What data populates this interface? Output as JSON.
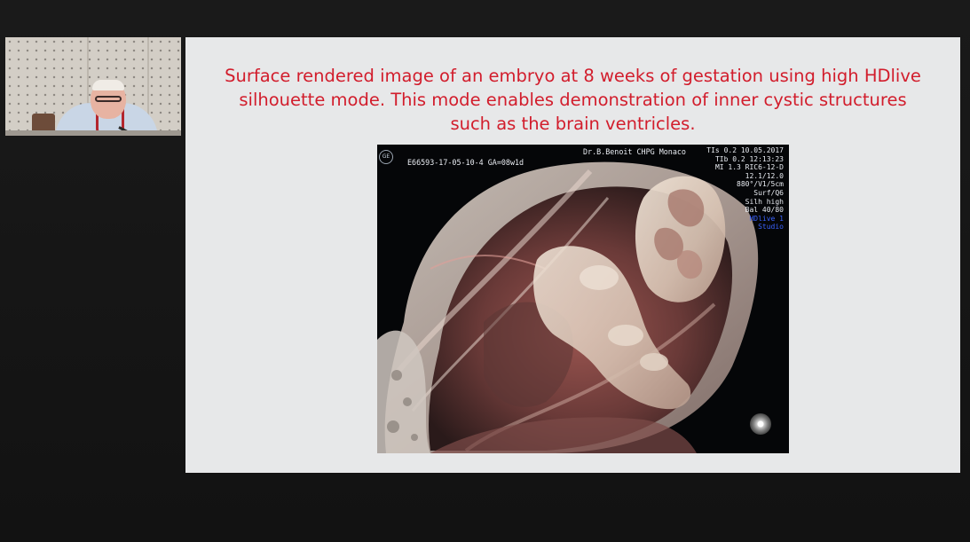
{
  "slide": {
    "title": "Surface rendered image of an embryo at 8 weeks of gestation using high HDlive silhouette mode. This mode enables demonstration of  inner cystic structures such as the brain ventricles."
  },
  "ultrasound": {
    "brand_text": "GE",
    "study_id": "E66593-17-05-10-4  GA=08w1d",
    "operator": "Dr.B.Benoit CHPG Monaco",
    "settings": [
      {
        "text": "TIs  0.2   10.05.2017",
        "accent": false
      },
      {
        "text": "TIb  0.2     12:13:23",
        "accent": false
      },
      {
        "text": "MI  1.3  RIC6-12-D",
        "accent": false
      },
      {
        "text": "12.1/12.0",
        "accent": false
      },
      {
        "text": "880°/V1/5cm",
        "accent": false
      },
      {
        "text": "Surf/Q6",
        "accent": false
      },
      {
        "text": "Silh high",
        "accent": false
      },
      {
        "text": "Bal 40/80",
        "accent": false
      },
      {
        "text": "HDlive 1",
        "accent": true
      },
      {
        "text": "Studio",
        "accent": true
      }
    ]
  },
  "colors": {
    "title_red": "#d21d2c",
    "slide_background": "#e7e8e9",
    "frame_background": "#141414",
    "settings_accent_blue": "#3b63ff"
  }
}
